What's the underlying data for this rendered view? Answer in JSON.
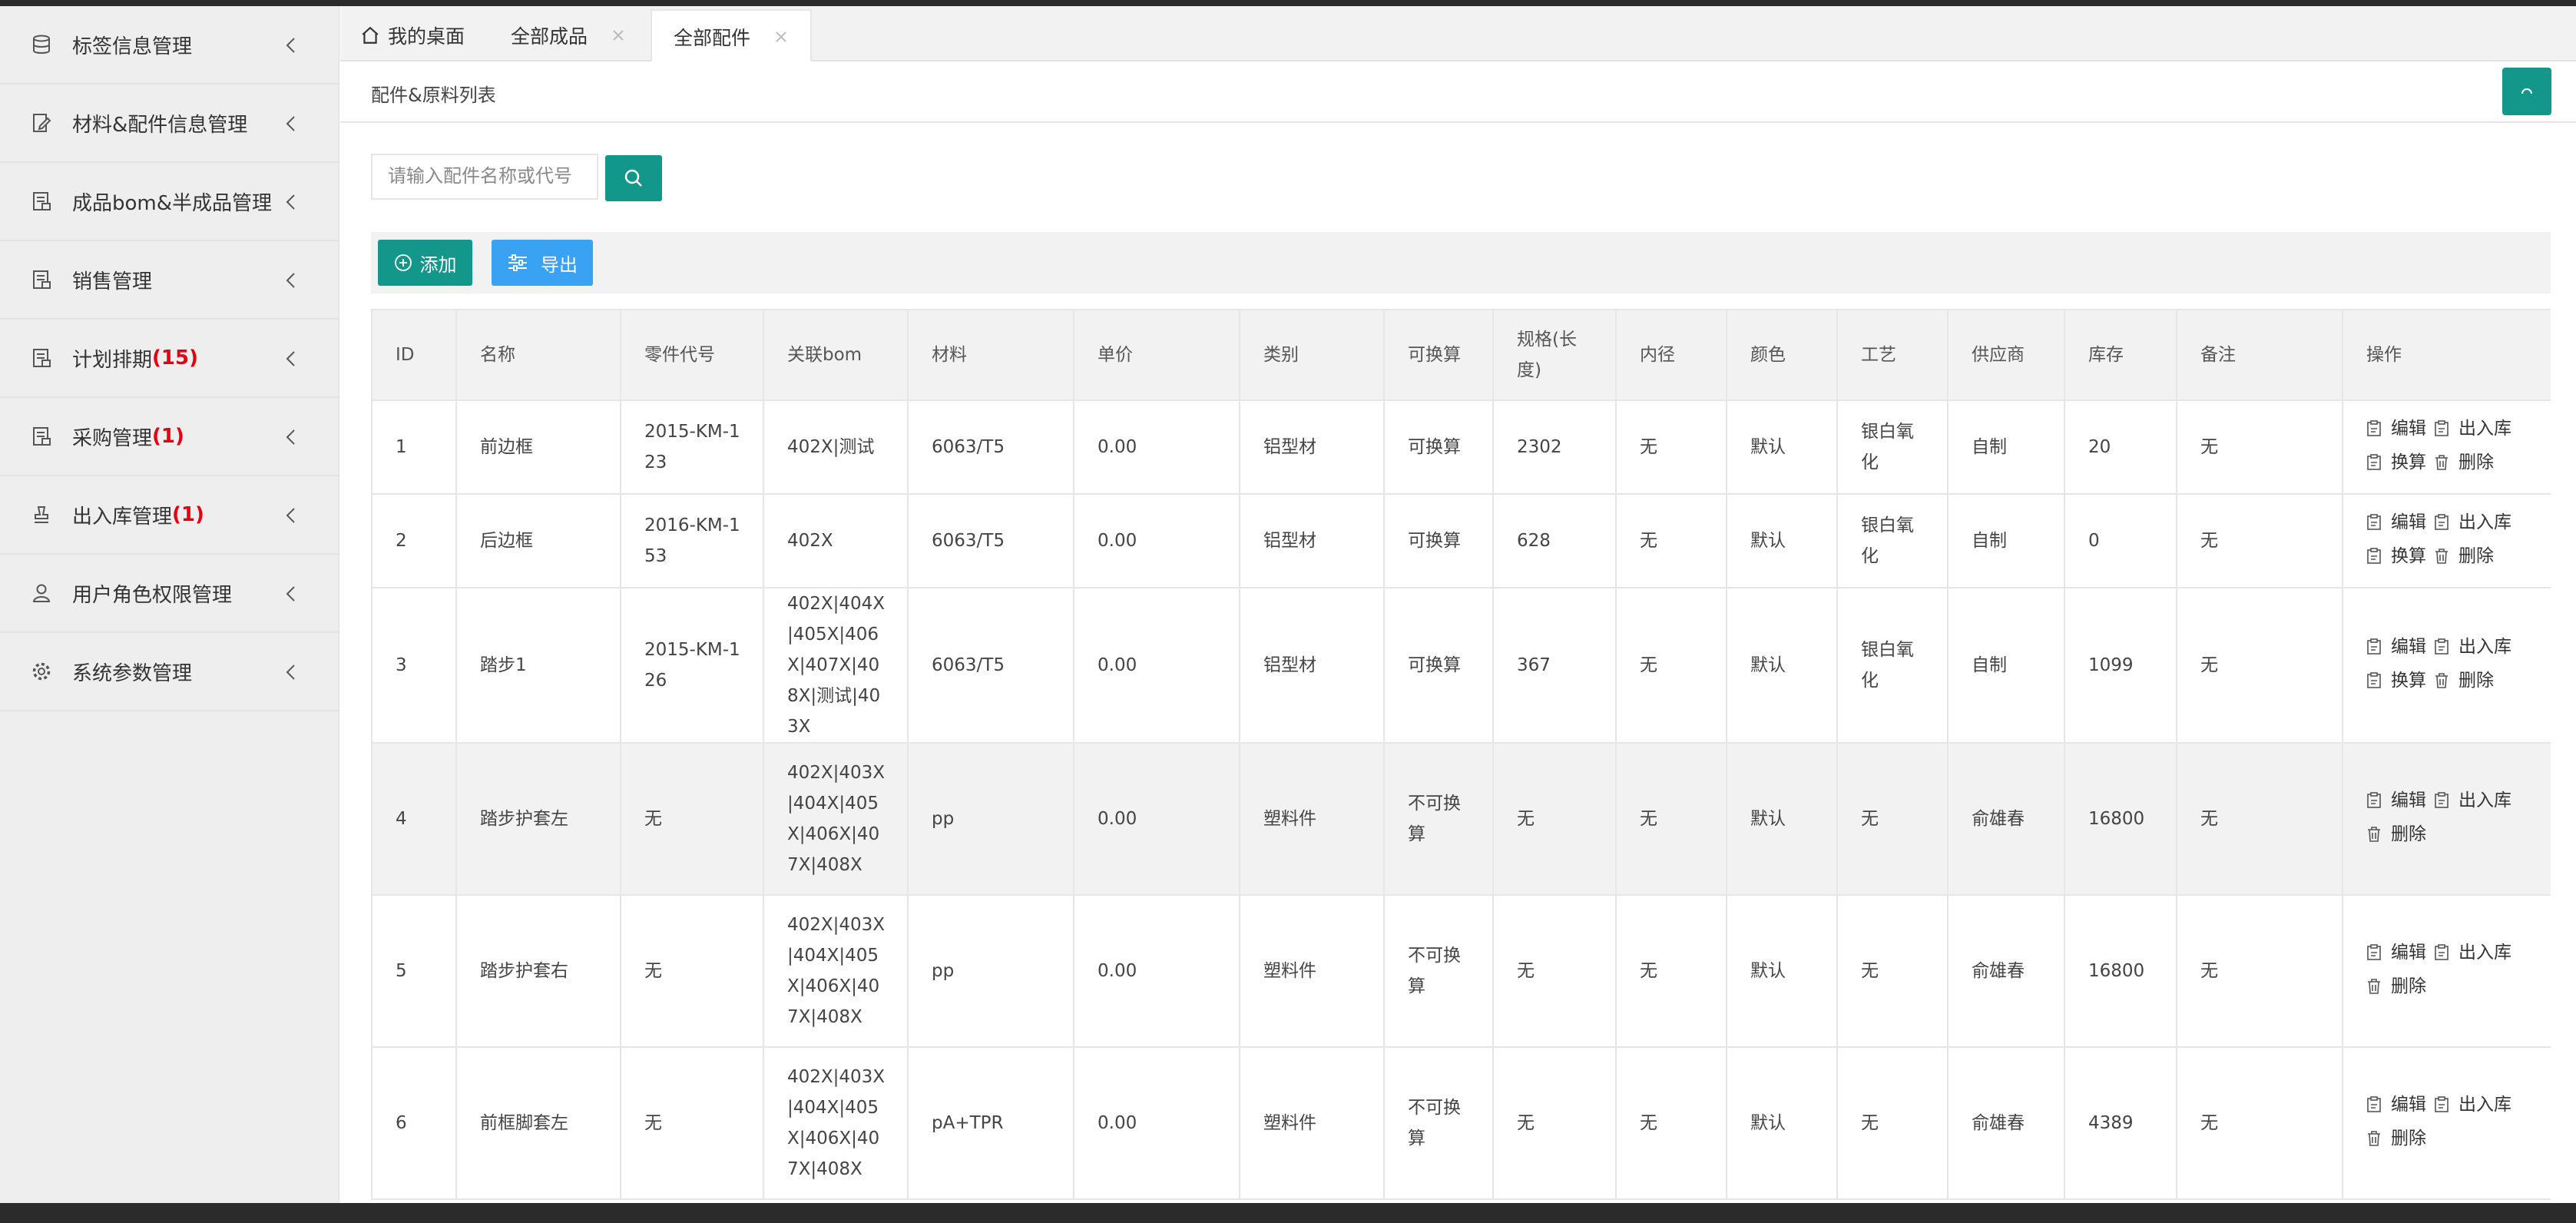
{
  "sidebar": {
    "items": [
      {
        "label": "标签信息管理",
        "badge": "",
        "icon": "database-icon"
      },
      {
        "label": "材料&配件信息管理",
        "badge": "",
        "icon": "edit-doc-icon"
      },
      {
        "label": "成品bom&半成品管理",
        "badge": "",
        "icon": "doc-icon"
      },
      {
        "label": "销售管理",
        "badge": "",
        "icon": "doc-icon"
      },
      {
        "label": "计划排期",
        "badge": "(15)",
        "icon": "doc-icon"
      },
      {
        "label": "采购管理",
        "badge": "(1)",
        "icon": "doc-icon"
      },
      {
        "label": "出入库管理",
        "badge": "(1)",
        "icon": "stamp-icon"
      },
      {
        "label": "用户角色权限管理",
        "badge": "",
        "icon": "user-icon"
      },
      {
        "label": "系统参数管理",
        "badge": "",
        "icon": "gear-icon"
      }
    ]
  },
  "tabs": [
    {
      "label": "我的桌面",
      "active": false
    },
    {
      "label": "全部成品",
      "active": false
    },
    {
      "label": "全部配件",
      "active": true
    }
  ],
  "breadcrumb": {
    "title": "配件&原料列表"
  },
  "search": {
    "placeholder": "请输入配件名称或代号",
    "value": ""
  },
  "toolbar": {
    "add_label": "添加",
    "export_label": "导出"
  },
  "table": {
    "headers": [
      "ID",
      "名称",
      "零件代号",
      "关联bom",
      "材料",
      "单价",
      "类别",
      "可换算",
      "规格(长度)",
      "内径",
      "颜色",
      "工艺",
      "供应商",
      "库存",
      "备注",
      "操作"
    ],
    "rows": [
      {
        "id": "1",
        "name": "前边框",
        "code": "2015-KM-123",
        "bom": "402X|测试",
        "material": "6063/T5",
        "price": "0.00",
        "category": "铝型材",
        "convertible": "可换算",
        "spec": "2302",
        "inner": "无",
        "color": "默认",
        "process": "银白氧化",
        "supplier": "自制",
        "stock": "20",
        "note": "无",
        "ops": [
          "编辑",
          "出入库",
          "换算",
          "删除"
        ]
      },
      {
        "id": "2",
        "name": "后边框",
        "code": "2016-KM-153",
        "bom": "402X",
        "material": "6063/T5",
        "price": "0.00",
        "category": "铝型材",
        "convertible": "可换算",
        "spec": "628",
        "inner": "无",
        "color": "默认",
        "process": "银白氧化",
        "supplier": "自制",
        "stock": "0",
        "note": "无",
        "ops": [
          "编辑",
          "出入库",
          "换算",
          "删除"
        ]
      },
      {
        "id": "3",
        "name": "踏步1",
        "code": "2015-KM-126",
        "bom": "402X|404X|405X|406X|407X|408X|测试|403X",
        "material": "6063/T5",
        "price": "0.00",
        "category": "铝型材",
        "convertible": "可换算",
        "spec": "367",
        "inner": "无",
        "color": "默认",
        "process": "银白氧化",
        "supplier": "自制",
        "stock": "1099",
        "note": "无",
        "ops": [
          "编辑",
          "出入库",
          "换算",
          "删除"
        ]
      },
      {
        "id": "4",
        "name": "踏步护套左",
        "code": "无",
        "bom": "402X|403X|404X|405X|406X|407X|408X",
        "material": "pp",
        "price": "0.00",
        "category": "塑料件",
        "convertible": "不可换算",
        "spec": "无",
        "inner": "无",
        "color": "默认",
        "process": "无",
        "supplier": "俞雄春",
        "stock": "16800",
        "note": "无",
        "ops": [
          "编辑",
          "出入库",
          "删除"
        ]
      },
      {
        "id": "5",
        "name": "踏步护套右",
        "code": "无",
        "bom": "402X|403X|404X|405X|406X|407X|408X",
        "material": "pp",
        "price": "0.00",
        "category": "塑料件",
        "convertible": "不可换算",
        "spec": "无",
        "inner": "无",
        "color": "默认",
        "process": "无",
        "supplier": "俞雄春",
        "stock": "16800",
        "note": "无",
        "ops": [
          "编辑",
          "出入库",
          "删除"
        ]
      },
      {
        "id": "6",
        "name": "前框脚套左",
        "code": "无",
        "bom": "402X|403X|404X|405X|406X|407X|408X",
        "material": "pA+TPR",
        "price": "0.00",
        "category": "塑料件",
        "convertible": "不可换算",
        "spec": "无",
        "inner": "无",
        "color": "默认",
        "process": "无",
        "supplier": "俞雄春",
        "stock": "4389",
        "note": "无",
        "ops": [
          "编辑",
          "出入库",
          "删除"
        ]
      }
    ]
  }
}
